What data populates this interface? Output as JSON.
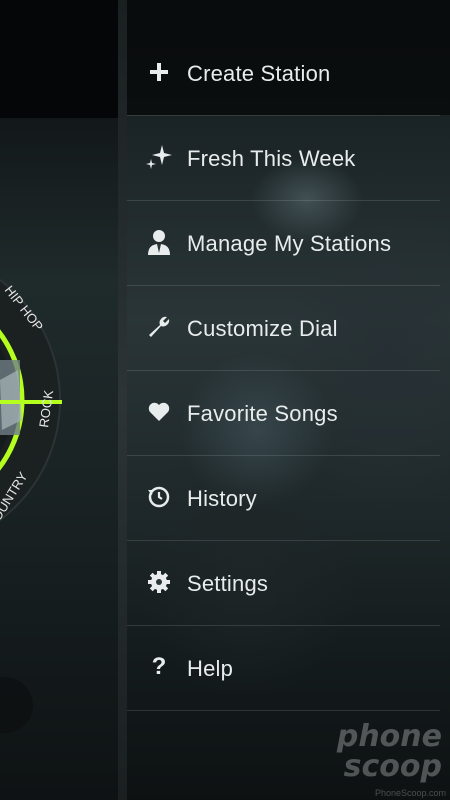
{
  "menu": {
    "items": [
      {
        "label": "Create Station",
        "icon": "plus-icon"
      },
      {
        "label": "Fresh This Week",
        "icon": "sparkle-icon"
      },
      {
        "label": "Manage My Stations",
        "icon": "person-icon"
      },
      {
        "label": "Customize Dial",
        "icon": "wrench-icon"
      },
      {
        "label": "Favorite Songs",
        "icon": "heart-icon"
      },
      {
        "label": "History",
        "icon": "history-icon"
      },
      {
        "label": "Settings",
        "icon": "gear-icon"
      },
      {
        "label": "Help",
        "icon": "question-icon"
      }
    ]
  },
  "dial": {
    "genres": [
      "HIP HOP",
      "ROCK",
      "COUNTRY"
    ],
    "accent_color": "#b4ff1e"
  },
  "watermark": {
    "line1": "phone",
    "line2": "scoop",
    "subtext": "PhoneScoop.com"
  }
}
